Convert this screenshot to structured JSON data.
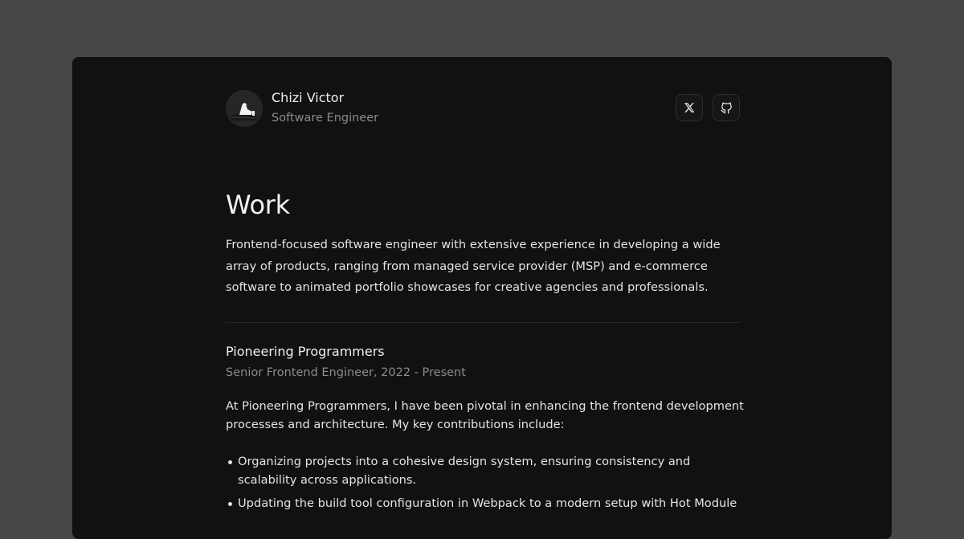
{
  "profile": {
    "name": "Chizi Victor",
    "role": "Software Engineer"
  },
  "social": [
    {
      "label": "X",
      "icon": "x-icon"
    },
    {
      "label": "GitHub",
      "icon": "github-icon"
    }
  ],
  "page": {
    "title": "Work",
    "intro_lines": [
      "Frontend-focused software engineer with extensive experience in developing a wide",
      "array of products, ranging from managed service provider (MSP) and e-commerce",
      "software to animated portfolio showcases for creative agencies and professionals."
    ]
  },
  "experience": [
    {
      "company": "Pioneering Programmers",
      "position": "Senior Frontend Engineer, 2022 - Present",
      "description_lines": [
        "At Pioneering Programmers, I have been pivotal in enhancing the frontend development",
        "processes and architecture. My key contributions include:"
      ],
      "bullets": [
        {
          "lines": [
            "Organizing projects into a cohesive design system, ensuring consistency and",
            "scalability across applications."
          ]
        },
        {
          "lines": [
            "Updating the build tool configuration in Webpack to a modern setup with Hot Module"
          ]
        }
      ]
    }
  ],
  "colors": {
    "outer_background": "#474747",
    "card_background": "#111111",
    "text_primary": "#efefef",
    "text_secondary": "#8b8b8b"
  }
}
